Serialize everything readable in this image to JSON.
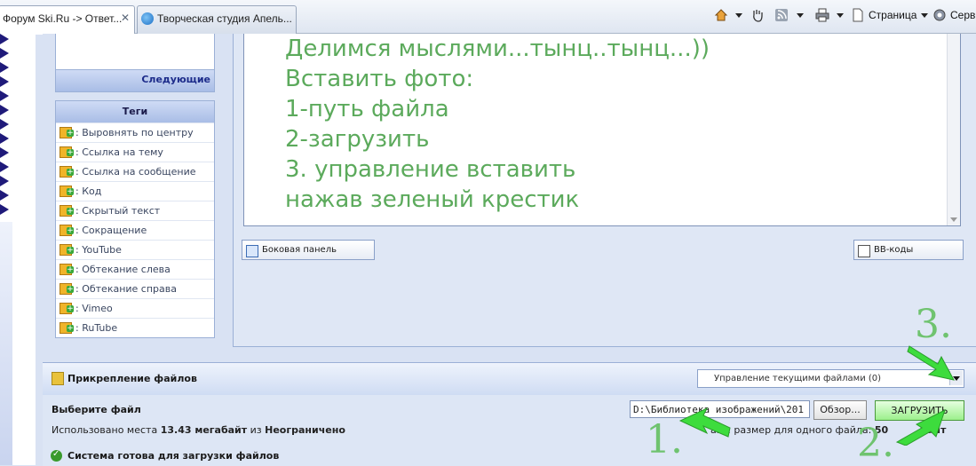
{
  "browser": {
    "tabs": [
      {
        "label": "Форум Ski.Ru -> Ответ...",
        "close": "✕"
      },
      {
        "label": "Творческая студия Апель..."
      }
    ],
    "toolbar": {
      "page_label": "Страница",
      "service_label": "Серв"
    }
  },
  "sidebar": {
    "next_label": "Следующие",
    "tags_title": "Теги",
    "tags": [
      {
        "label": ": Выровнять по центру"
      },
      {
        "label": ": Ссылка на тему"
      },
      {
        "label": ": Ссылка на сообщение"
      },
      {
        "label": ": Код"
      },
      {
        "label": ": Скрытый текст"
      },
      {
        "label": ": Сокращение"
      },
      {
        "label": ": YouTube"
      },
      {
        "label": ": Обтекание слева"
      },
      {
        "label": ": Обтекание справа"
      },
      {
        "label": ": Vimeo"
      },
      {
        "label": ": RuTube"
      }
    ]
  },
  "editor": {
    "lines": [
      "Делимся  мыслями...тынц..тынц...))",
      "Вставить фото:",
      "1-путь файла",
      "2-загрузить",
      "3. управление вставить",
      "нажав зеленый крестик"
    ],
    "sidebar_button": "Боковая панель",
    "bbcodes_button": "BB-коды"
  },
  "attachments": {
    "title": "Прикрепление файлов",
    "manage_select": "Управление текущими файлами (0)",
    "choose_file_label": "Выберите файл",
    "file_path": "D:\\Библиотека изображений\\201",
    "browse_button": "Обзор...",
    "upload_button": "ЗАГРУЗИТЬ",
    "usage_prefix": "Использовано места ",
    "usage_value": "13.43 мегабайт",
    "usage_mid": " из ",
    "usage_limit": "Неограничено",
    "max_size_prefix": "акс. размер для одного файла: ",
    "max_size_value": "50",
    "max_size_suffix": "байт",
    "status": "Система готова для загрузки файлов"
  },
  "annotations": {
    "step1": "1.",
    "step2": "2.",
    "step3": "3."
  },
  "colors": {
    "annotation_green": "#6fc36f",
    "arrow_green": "#3ddc3d",
    "editor_text": "#5caa5c"
  }
}
